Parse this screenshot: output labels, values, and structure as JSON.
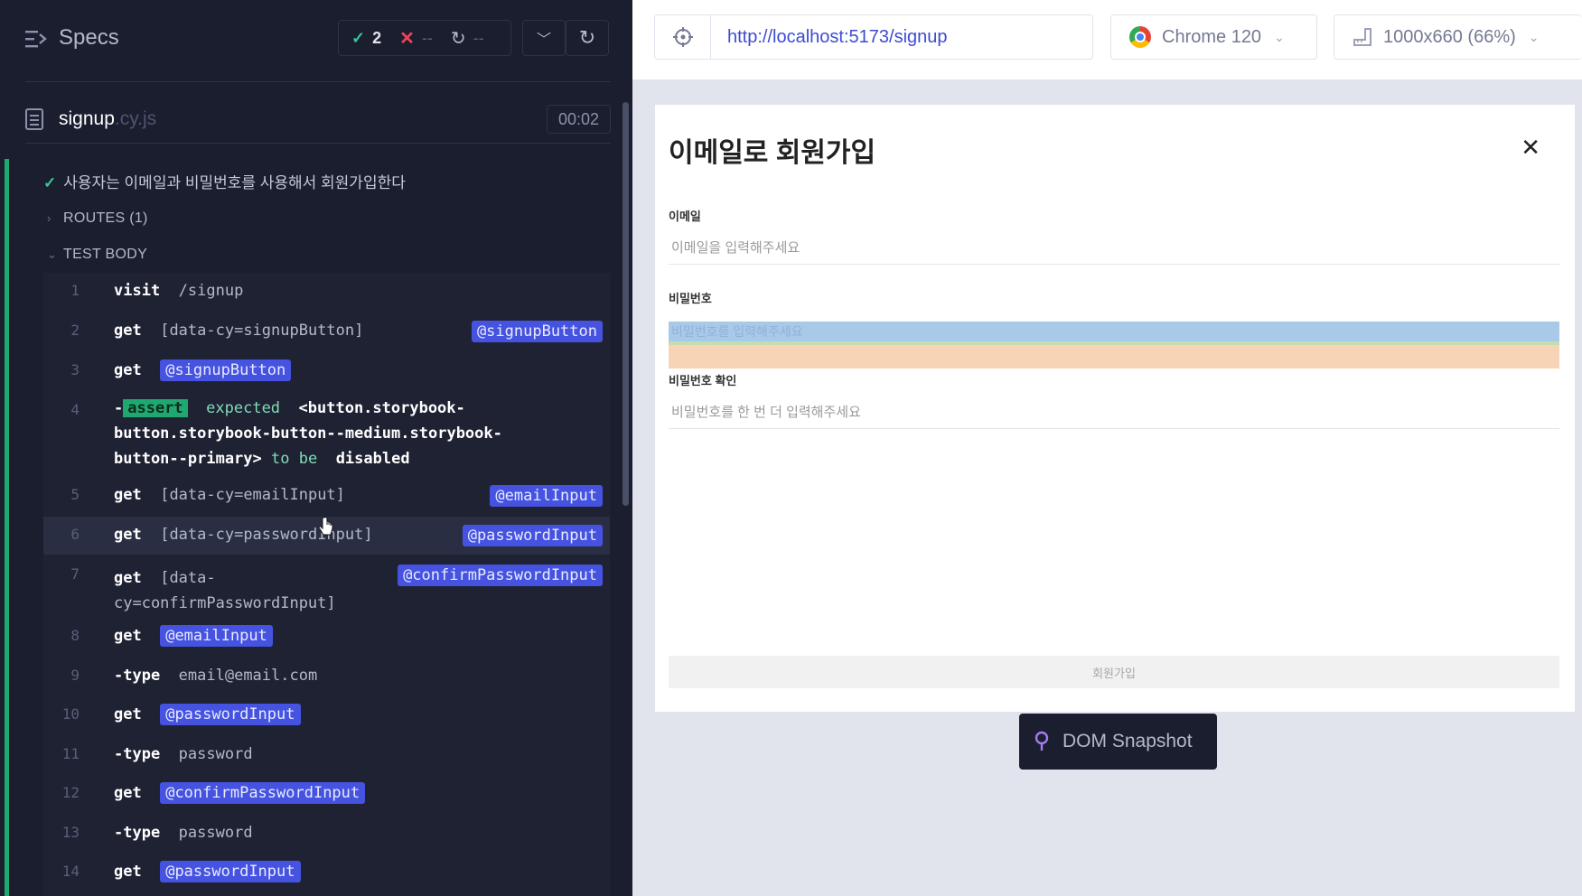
{
  "specs": {
    "title": "Specs",
    "passed": "2",
    "failed": "--",
    "pending": "--"
  },
  "spec_file": {
    "name": "signup",
    "ext": ".cy.js",
    "time": "00:02"
  },
  "test": {
    "title": "사용자는 이메일과 비밀번호를 사용해서 회원가입한다",
    "routes_label": "ROUTES (1)",
    "body_label": "TEST BODY"
  },
  "commands": [
    {
      "num": "1",
      "cmd": "visit",
      "arg": "/signup"
    },
    {
      "num": "2",
      "cmd": "get",
      "arg": "[data-cy=signupButton]",
      "alias": "@signupButton"
    },
    {
      "num": "3",
      "cmd": "get",
      "alias_inline": "@signupButton"
    },
    {
      "num": "4",
      "cmd": "-",
      "badge": "assert",
      "expected": "expected",
      "line1": "<button.storybook-",
      "line2": "button.storybook-button--medium.storybook-",
      "line3": "button--primary>",
      "to_be": "to be",
      "disabled": "disabled"
    },
    {
      "num": "5",
      "cmd": "get",
      "arg": "[data-cy=emailInput]",
      "alias": "@emailInput"
    },
    {
      "num": "6",
      "cmd": "get",
      "arg": "[data-cy=passwordInput]",
      "alias": "@passwordInput"
    },
    {
      "num": "7",
      "cmd": "get",
      "arg": "[data-",
      "arg2": "cy=confirmPasswordInput]",
      "alias": "@confirmPasswordInput"
    },
    {
      "num": "8",
      "cmd": "get",
      "alias_inline": "@emailInput"
    },
    {
      "num": "9",
      "cmd": "-type",
      "arg": "email@email.com"
    },
    {
      "num": "10",
      "cmd": "get",
      "alias_inline": "@passwordInput"
    },
    {
      "num": "11",
      "cmd": "-type",
      "arg": "password"
    },
    {
      "num": "12",
      "cmd": "get",
      "alias_inline": "@confirmPasswordInput"
    },
    {
      "num": "13",
      "cmd": "-type",
      "arg": "password"
    },
    {
      "num": "14",
      "cmd": "get",
      "alias_inline": "@passwordInput"
    }
  ],
  "toolbar": {
    "url": "http://localhost:5173/signup",
    "browser": "Chrome 120",
    "viewport": "1000x660 (66%)"
  },
  "form": {
    "title": "이메일로 회원가입",
    "email_label": "이메일",
    "email_placeholder": "이메일을 입력해주세요",
    "password_label": "비밀번호",
    "password_placeholder": "비밀번호를 입력해주세요",
    "confirm_label": "비밀번호 확인",
    "confirm_placeholder": "비밀번호를 한 번 더 입력해주세요",
    "submit_label": "회원가입"
  },
  "snapshot": {
    "label": "DOM Snapshot"
  },
  "colors": {
    "pass": "#3ac596",
    "fail": "#f0425b",
    "alias": "#4553e0",
    "url": "#3d4bd3"
  }
}
